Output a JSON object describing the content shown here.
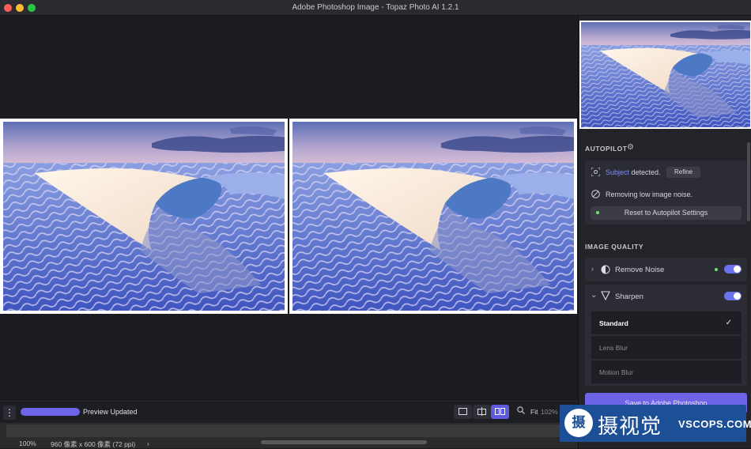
{
  "window": {
    "title": "Adobe Photoshop Image - Topaz Photo AI 1.2.1"
  },
  "autopilot": {
    "label": "AUTOPILOT",
    "subject_link": "Subject",
    "subject_text": " detected.",
    "refine_label": "Refine",
    "noise_text": "Removing low image noise.",
    "reset_label": "Reset to Autopilot Settings"
  },
  "image_quality": {
    "label": "IMAGE QUALITY",
    "remove_noise": {
      "label": "Remove Noise",
      "enabled": true
    },
    "sharpen": {
      "label": "Sharpen",
      "enabled": true,
      "options": [
        "Standard",
        "Lens Blur",
        "Motion Blur"
      ],
      "selected": "Standard"
    }
  },
  "save_button": "Save to Adobe Photoshop",
  "bottom_bar": {
    "status": "Preview Updated",
    "progress": 1.0,
    "zoom_fit": "Fit",
    "zoom_pct": "102%"
  },
  "photoshop_status": {
    "zoom": "100%",
    "info": "960 像素 x 600 像素 (72 ppi)",
    "arrow": "›"
  },
  "watermark": {
    "logo": "摄",
    "chinese": "摄视觉",
    "english": "VSCOPS.COM"
  },
  "icons": {
    "gear": "gear-icon",
    "subject": "subject-detect-icon",
    "noise": "noise-icon",
    "sharpen": "sharpen-icon",
    "zoom": "zoom-icon",
    "menu": "more-vertical-icon"
  },
  "colors": {
    "accent": "#6e64e8",
    "link": "#7d8cff",
    "status_dot": "#6de26d"
  }
}
